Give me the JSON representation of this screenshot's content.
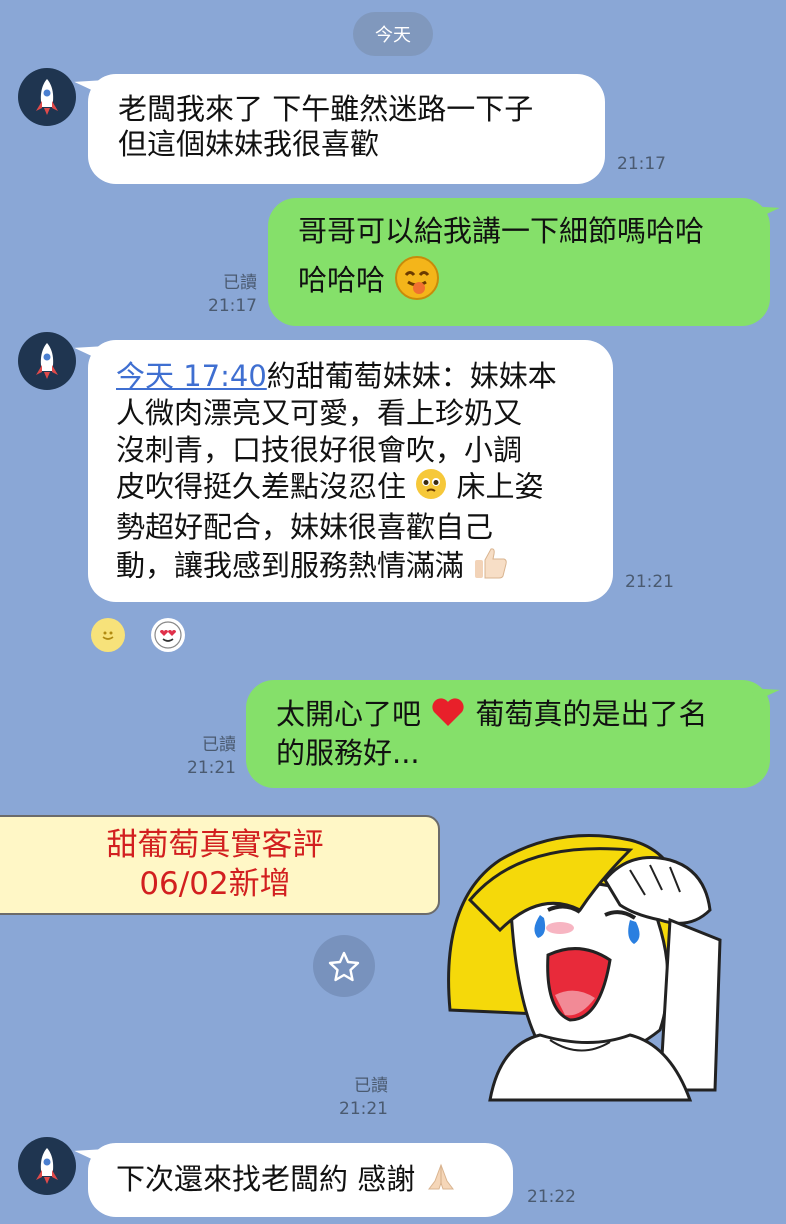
{
  "date_separator": "今天",
  "messages": [
    {
      "lines": [
        "老闆我來了 下午雖然迷路一下子",
        "但這個妹妹我很喜歡"
      ],
      "time": "21:17"
    },
    {
      "line1": "哥哥可以給我講一下細節嗎哈哈",
      "line2": "哈哈哈",
      "read": "已讀",
      "time": "21:17"
    },
    {
      "link": "今天 17:40",
      "line1_rest": "約甜葡萄妹妹：妹妹本",
      "line2": "人微肉漂亮又可愛，看上珍奶又",
      "line3": "沒刺青，口技很好很會吹，小調",
      "line4_a": "皮吹得挺久差點沒忍住",
      "line4_b": "床上姿",
      "line5": "勢超好配合，妹妹很喜歡自己",
      "line6": "動，讓我感到服務熱情滿滿",
      "time": "21:21"
    },
    {
      "line1_a": "太開心了吧",
      "line1_b": "葡萄真的是出了名",
      "line2": "的服務好...",
      "read": "已讀",
      "time": "21:21"
    },
    {
      "read": "已讀",
      "time": "21:21"
    },
    {
      "text": "下次還來找老闆約 感謝",
      "time": "21:22"
    }
  ],
  "banner": {
    "line1": "甜葡萄真實客評",
    "line2": "06/02新增"
  },
  "icons": {
    "avatar": "rocket-icon",
    "reactions": [
      "smile-face-icon",
      "heart-eyes-face-icon"
    ],
    "star": "star-icon",
    "sticker": "crying-girl-sticker"
  },
  "colors": {
    "background": "#8aa7d6",
    "my_bubble": "#85e06a",
    "their_bubble": "#ffffff",
    "banner_text": "#d21f1f"
  }
}
